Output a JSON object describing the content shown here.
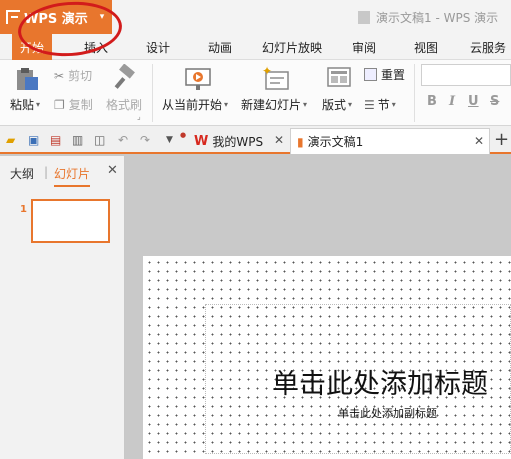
{
  "titlebar": {
    "app_name": "WPS 演示",
    "app_caret": "▾",
    "document_title": "演示文稿1 - WPS 演示"
  },
  "menu": {
    "tabs": [
      "开始",
      "插入",
      "设计",
      "动画",
      "幻灯片放映",
      "审阅",
      "视图",
      "云服务"
    ]
  },
  "ribbon": {
    "paste": "粘贴",
    "cut": "剪切",
    "copy": "复制",
    "format_painter": "格式刷",
    "from_current": "从当前开始",
    "new_slide": "新建幻灯片",
    "layout": "版式",
    "reset": "重置",
    "section": "节",
    "bold": "B",
    "italic": "I",
    "underline": "U",
    "strike": "S"
  },
  "doc_tabs": {
    "my_wps": "我的WPS",
    "presentation": "演示文稿1"
  },
  "left_pane": {
    "outline_tab": "大纲",
    "slides_tab": "幻灯片",
    "slide_number": "1"
  },
  "slide": {
    "title_placeholder": "单击此处添加标题",
    "subtitle_placeholder": "单击此处添加副标题"
  },
  "colors": {
    "accent": "#e8762d",
    "annotation": "#d21b1b"
  }
}
